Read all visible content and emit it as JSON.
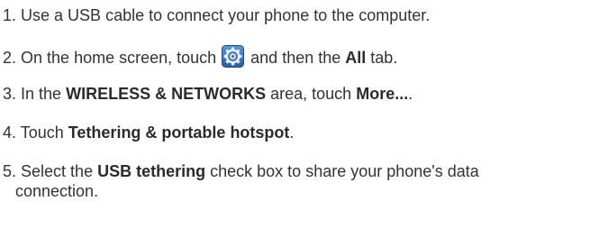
{
  "steps": [
    {
      "num": "1.",
      "text": "Use a USB cable to connect your phone to the computer."
    },
    {
      "num": "2.",
      "t1": "On the home screen, touch",
      "t2": "and then the",
      "b1": "All",
      "t3": "tab.",
      "icon": "settings-gear-icon"
    },
    {
      "num": "3.",
      "t1": "In the",
      "b1": "WIRELESS & NETWORKS",
      "t2": "area, touch",
      "b2": "More...",
      "t3": "."
    },
    {
      "num": "4.",
      "t1": "Touch",
      "b1": "Tethering & portable hotspot",
      "t2": "."
    },
    {
      "num": "5.",
      "t1": "Select the",
      "b1": "USB tethering",
      "t2": "check box to share your phone's data",
      "t3": "connection."
    }
  ],
  "colors": {
    "text": "#333333",
    "icon_bg": "#3a7fc3",
    "icon_ring": "#dfe8f1"
  }
}
